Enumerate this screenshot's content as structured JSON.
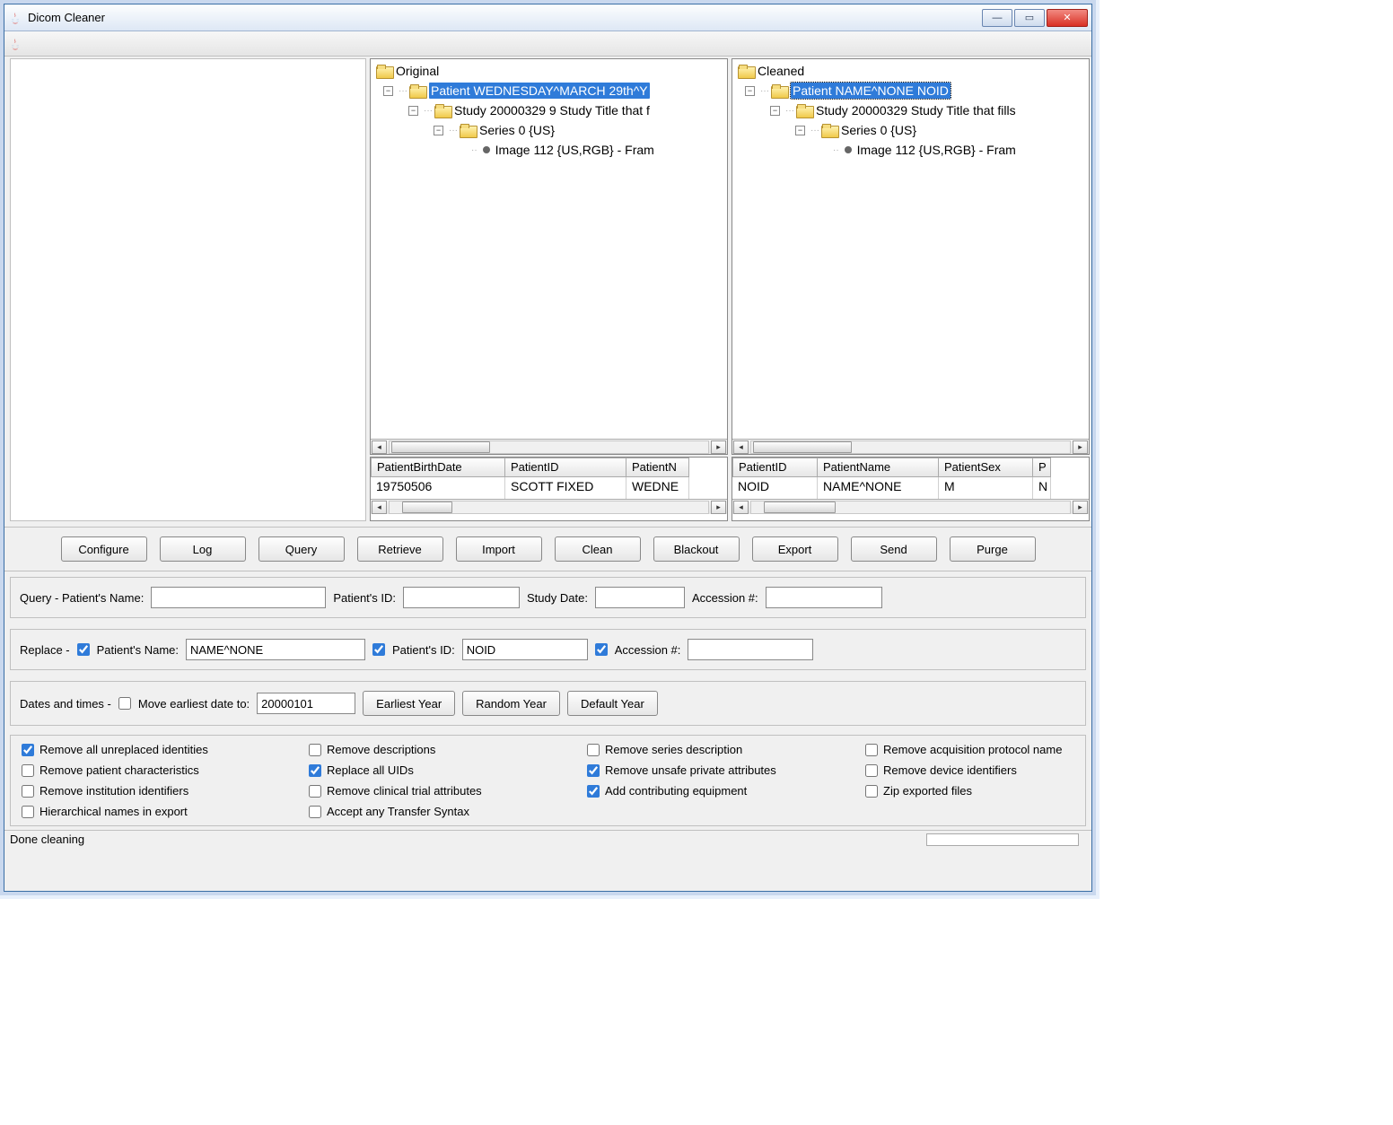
{
  "window": {
    "title": "Dicom Cleaner"
  },
  "trees": {
    "original": {
      "root": "Original",
      "patient": "Patient WEDNESDAY^MARCH 29th^Y",
      "study": "Study 20000329 9 Study Title that f",
      "series": "Series 0 {US}",
      "image": "Image 112 {US,RGB} - Fram"
    },
    "cleaned": {
      "root": "Cleaned",
      "patient": "Patient NAME^NONE NOID",
      "study": "Study 20000329 Study Title that fills",
      "series": "Series 0 {US}",
      "image": "Image 112 {US,RGB} - Fram"
    }
  },
  "tables": {
    "original": {
      "headers": [
        "PatientBirthDate",
        "PatientID",
        "PatientN"
      ],
      "row": [
        "19750506",
        "SCOTT FIXED",
        "WEDNE"
      ]
    },
    "cleaned": {
      "headers": [
        "PatientID",
        "PatientName",
        "PatientSex",
        "P"
      ],
      "row": [
        "NOID",
        "NAME^NONE",
        "M",
        "N"
      ]
    }
  },
  "buttons": {
    "configure": "Configure",
    "log": "Log",
    "query": "Query",
    "retrieve": "Retrieve",
    "import": "Import",
    "clean": "Clean",
    "blackout": "Blackout",
    "export": "Export",
    "send": "Send",
    "purge": "Purge"
  },
  "queryRow": {
    "label": "Query - Patient's Name:",
    "pname": "",
    "pidLabel": "Patient's ID:",
    "pid": "",
    "dateLabel": "Study Date:",
    "date": "",
    "accLabel": "Accession #:",
    "acc": ""
  },
  "replaceRow": {
    "label": "Replace - ",
    "cbName": true,
    "nameLabel": "Patient's Name:",
    "name": "NAME^NONE",
    "cbId": true,
    "idLabel": "Patient's ID:",
    "id": "NOID",
    "cbAcc": true,
    "accLabel": "Accession #:",
    "acc": ""
  },
  "datesRow": {
    "label": "Dates and times - ",
    "cbMove": false,
    "moveLabel": "Move earliest date to:",
    "date": "20000101",
    "btnEarliest": "Earliest Year",
    "btnRandom": "Random Year",
    "btnDefault": "Default Year"
  },
  "checks": [
    {
      "key": "remove_unreplaced",
      "label": "Remove all unreplaced identities",
      "checked": true
    },
    {
      "key": "remove_descriptions",
      "label": "Remove descriptions",
      "checked": false
    },
    {
      "key": "remove_series_desc",
      "label": "Remove series description",
      "checked": false
    },
    {
      "key": "remove_acq_proto",
      "label": "Remove acquisition protocol name",
      "checked": false
    },
    {
      "key": "remove_patient_char",
      "label": "Remove patient characteristics",
      "checked": false
    },
    {
      "key": "replace_uids",
      "label": "Replace all UIDs",
      "checked": true
    },
    {
      "key": "remove_unsafe_priv",
      "label": "Remove unsafe private attributes",
      "checked": true
    },
    {
      "key": "remove_device",
      "label": "Remove device identifiers",
      "checked": false
    },
    {
      "key": "remove_institution",
      "label": "Remove institution identifiers",
      "checked": false
    },
    {
      "key": "remove_clinical_trial",
      "label": "Remove clinical trial attributes",
      "checked": false
    },
    {
      "key": "add_contrib_equip",
      "label": "Add contributing equipment",
      "checked": true
    },
    {
      "key": "zip_exported",
      "label": "Zip exported files",
      "checked": false
    },
    {
      "key": "hierarchical_names",
      "label": "Hierarchical names in export",
      "checked": false
    },
    {
      "key": "accept_any_ts",
      "label": "Accept any Transfer Syntax",
      "checked": false
    }
  ],
  "status": "Done cleaning"
}
